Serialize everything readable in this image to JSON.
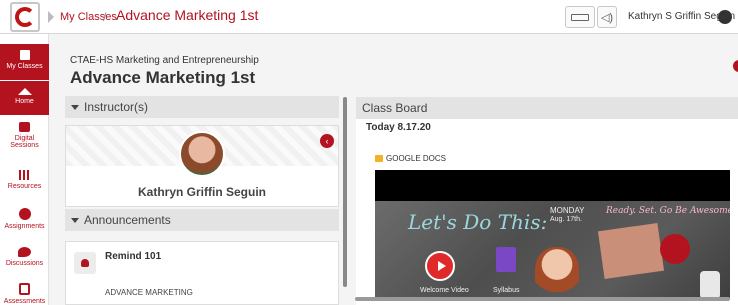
{
  "header": {
    "breadcrumb_link": "My Classes",
    "breadcrumb_sep": "/",
    "breadcrumb_current": "Advance Marketing 1st",
    "user_name": "Kathryn S Griffin Seguin"
  },
  "sidebar": {
    "items": [
      {
        "label": "My Classes",
        "icon": "classes-icon",
        "active": true
      },
      {
        "label": "Home",
        "icon": "home-icon",
        "active": true
      },
      {
        "label": "Digital Sessions",
        "icon": "sessions-icon",
        "active": false
      },
      {
        "label": "Resources",
        "icon": "resources-icon",
        "active": false
      },
      {
        "label": "Assignments",
        "icon": "assignments-icon",
        "active": false
      },
      {
        "label": "Discussions",
        "icon": "discussions-icon",
        "active": false
      },
      {
        "label": "Assessments",
        "icon": "assessments-icon",
        "active": false
      }
    ]
  },
  "course": {
    "subtitle": "CTAE-HS Marketing and Entrepreneurship",
    "title": "Advance Marketing 1st"
  },
  "instructors": {
    "heading": "Instructor(s)",
    "name": "Kathryn Griffin Seguin"
  },
  "announcements": {
    "heading": "Announcements",
    "title": "Remind 101",
    "body": "ADVANCE MARKETING"
  },
  "class_board": {
    "heading": "Class Board",
    "date": "Today 8.17.20",
    "doc_label": "GOOGLE DOCS",
    "slide": {
      "script_text": "Let's Do This:",
      "day": "MONDAY",
      "date": "Aug. 17th.",
      "ready_text": "Ready. Set. Go Be Awesome!",
      "video_label": "Welcome Video",
      "syllabus_label": "Syllabus"
    }
  },
  "colors": {
    "accent": "#b3121f",
    "panel_head": "#e3e3e3"
  }
}
